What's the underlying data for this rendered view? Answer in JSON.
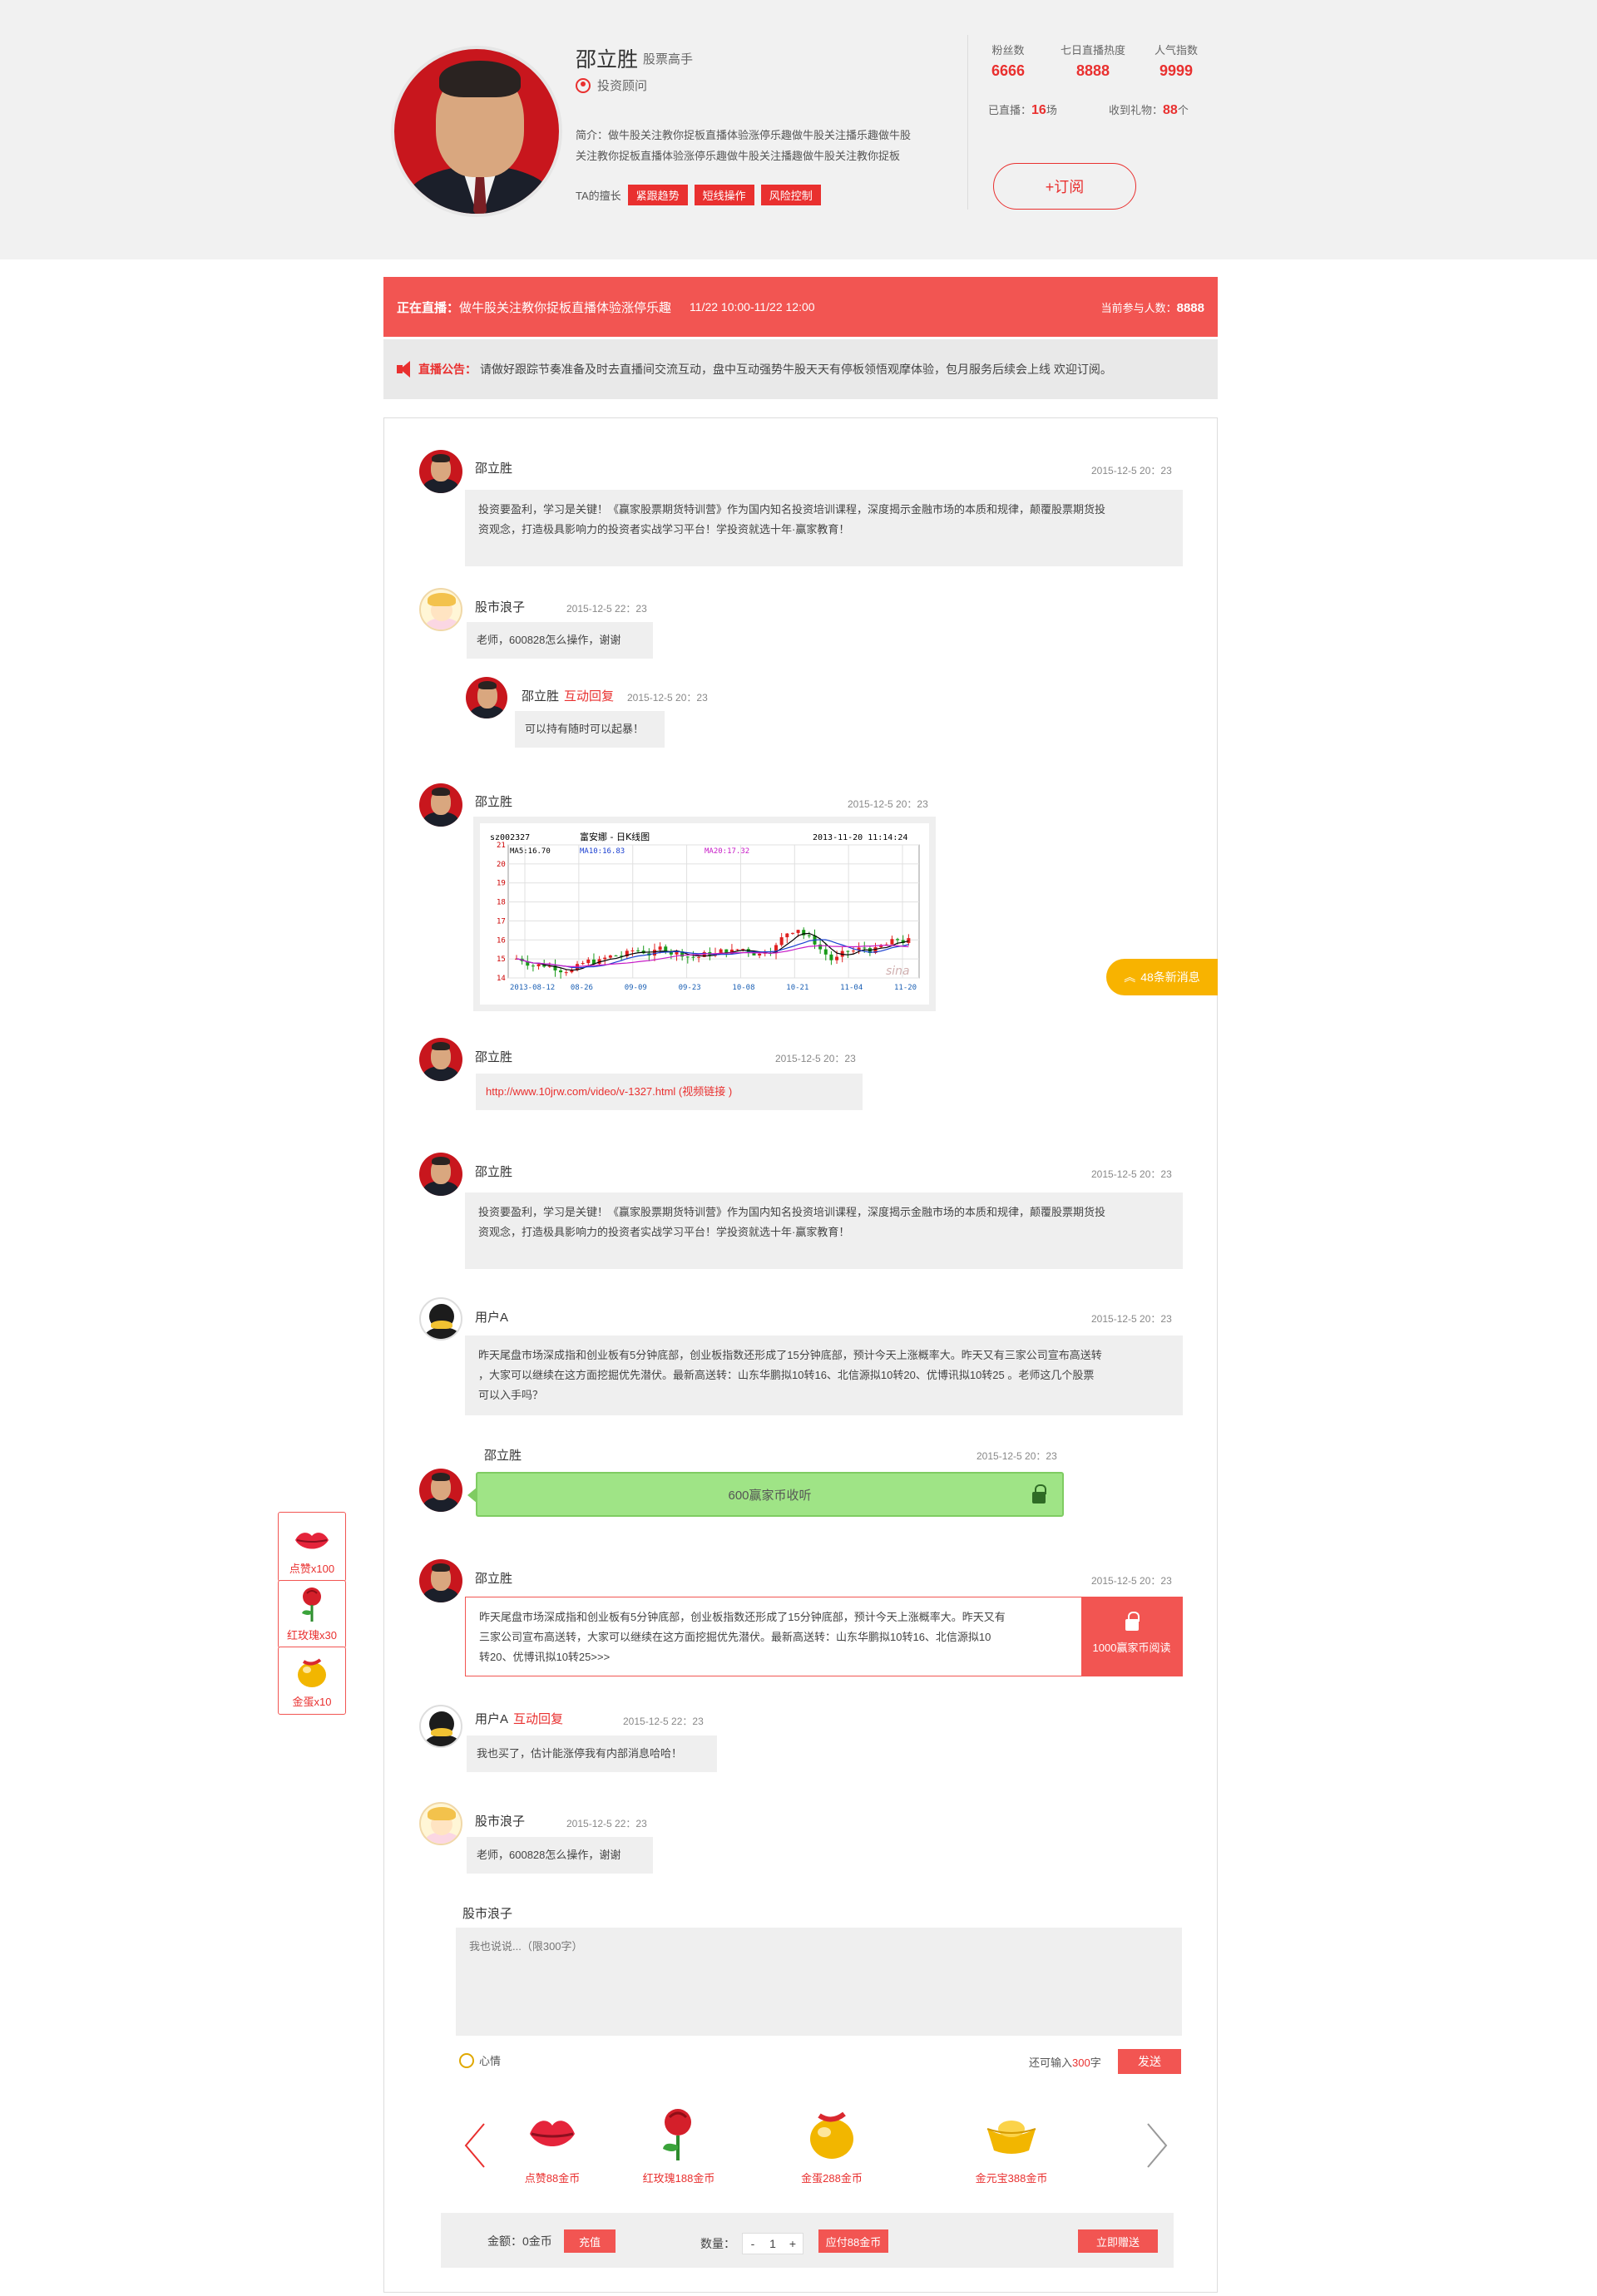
{
  "profile": {
    "name": "邵立胜",
    "level": "股票高手",
    "role": "投资顾问",
    "intro_line1": "简介：做牛股关注教你捉板直播体验涨停乐趣做牛股关注播乐趣做牛股",
    "intro_line2": "关注教你捉板直播体验涨停乐趣做牛股关注播趣做牛股关注教你捉板",
    "skills_label": "TA的擅长",
    "skills": [
      "紧跟趋势",
      "短线操作",
      "风险控制"
    ],
    "stats": [
      {
        "label": "粉丝数",
        "value": "6666"
      },
      {
        "label": "七日直播热度",
        "value": "8888"
      },
      {
        "label": "人气指数",
        "value": "9999"
      }
    ],
    "live_count_label": "已直播：",
    "live_count": "16",
    "live_count_unit": "场",
    "gift_label": "收到礼物：",
    "gift_count": "88",
    "gift_unit": "个",
    "subscribe_label": "+订阅"
  },
  "live": {
    "label": "正在直播：",
    "title": "做牛股关注教你捉板直播体验涨停乐趣",
    "when": "11/22 10:00-11/22 12:00",
    "participants_label": "当前参与人数：",
    "participants": "8888"
  },
  "notice": {
    "label": "直播公告：",
    "text": "请做好跟踪节奏准备及时去直播间交流互动，盘中互动强势牛股天天有停板领悟观摩体验，包月服务后续会上线 欢迎订阅。"
  },
  "messages": {
    "m1": {
      "user": "邵立胜",
      "time": "2015-12-5  20：23",
      "line1": "投资要盈利，学习是关键！《赢家股票期货特训营》作为国内知名投资培训课程，深度揭示金融市场的本质和规律，颠覆股票期货投",
      "line2": "资观念，打造极具影响力的投资者实战学习平台！学投资就选十年·赢家教育！"
    },
    "m2": {
      "user": "股市浪子",
      "time": "2015-12-5  22：23",
      "text": "老师，600828怎么操作，谢谢"
    },
    "m2r": {
      "user": "邵立胜",
      "reply": "互动回复",
      "time": "2015-12-5  20：23",
      "text": "可以持有随时可以起暴！"
    },
    "m3": {
      "user": "邵立胜",
      "time": "2015-12-5  20：23"
    },
    "m4": {
      "user": "邵立胜",
      "time": "2015-12-5  20：23",
      "link": "http://www.10jrw.com/video/v-1327.html (视频链接 )"
    },
    "m5": {
      "user": "邵立胜",
      "time": "2015-12-5  20：23",
      "line1": "投资要盈利，学习是关键！《赢家股票期货特训营》作为国内知名投资培训课程，深度揭示金融市场的本质和规律，颠覆股票期货投",
      "line2": "资观念，打造极具影响力的投资者实战学习平台！学投资就选十年·赢家教育！"
    },
    "m6": {
      "user": "用户A",
      "time": "2015-12-5  20：23",
      "line1": "昨天尾盘市场深成指和创业板有5分钟底部，创业板指数还形成了15分钟底部，预计今天上涨概率大。昨天又有三家公司宣布高送转",
      "line2": "，大家可以继续在这方面挖掘优先潜伏。最新高送转：山东华鹏拟10转16、北信源拟10转20、优博讯拟10转25 。老师这几个股票",
      "line3": "可以入手吗？"
    },
    "m7": {
      "user": "邵立胜",
      "time": "2015-12-5  20：23",
      "pay_text": "600赢家币收听"
    },
    "m8": {
      "user": "邵立胜",
      "time": "2015-12-5  20：23",
      "line1": "昨天尾盘市场深成指和创业板有5分钟底部，创业板指数还形成了15分钟底部，预计今天上涨概率大。昨天又有",
      "line2": "三家公司宣布高送转，大家可以继续在这方面挖掘优先潜伏。最新高送转：山东华鹏拟10转16、北信源拟10",
      "line3": "转20、优博讯拟10转25>>>",
      "read_label": "1000赢家币阅读"
    },
    "m9": {
      "user": "用户A",
      "reply": "互动回复",
      "time": "2015-12-5  22：23",
      "text": "我也买了，估计能涨停我有内部消息哈哈！"
    },
    "m10": {
      "user": "股市浪子",
      "time": "2015-12-5  22：23",
      "text": "老师，600828怎么操作，谢谢"
    }
  },
  "chart": {
    "code": "sz002327",
    "name": "富安娜  -  日K线图",
    "datetime": "2013-11-20  11:14:24",
    "ma5": "MA5:16.70",
    "ma10": "MA10:16.83",
    "ma20": "MA20:17.32",
    "watermark": "sina",
    "y_ticks": [
      "21",
      "20",
      "19",
      "18",
      "17",
      "16",
      "15",
      "14"
    ],
    "x_ticks": [
      "2013-08-12",
      "08-26",
      "09-09",
      "09-23",
      "10-08",
      "10-21",
      "11-04",
      "11-20"
    ]
  },
  "new_messages": "48条新消息",
  "side_gifts": [
    "点赞x100",
    "红玫瑰x30",
    "金蛋x10"
  ],
  "composer": {
    "name": "股市浪子",
    "placeholder": "我也说说...（限300字）",
    "mood": "心情",
    "remain_prefix": "还可输入",
    "remain_num": "300",
    "remain_suffix": "字",
    "send": "发送"
  },
  "gifts": [
    {
      "label": "点赞88金币",
      "icon": "lips-icon"
    },
    {
      "label": "红玫瑰188金币",
      "icon": "rose-icon"
    },
    {
      "label": "金蛋288金币",
      "icon": "golden-egg-icon"
    },
    {
      "label": "金元宝388金币",
      "icon": "gold-ingot-icon"
    }
  ],
  "paybar": {
    "amount_label": "金额：",
    "amount": "0金币",
    "recharge": "充值",
    "qty_label": "数量：",
    "minus": "-",
    "qty": "1",
    "plus": "+",
    "due": "应付88金币",
    "give": "立即赠送"
  },
  "colors": {
    "accent": "#f25552",
    "green": "#9fe486",
    "gold": "#f8b300"
  }
}
